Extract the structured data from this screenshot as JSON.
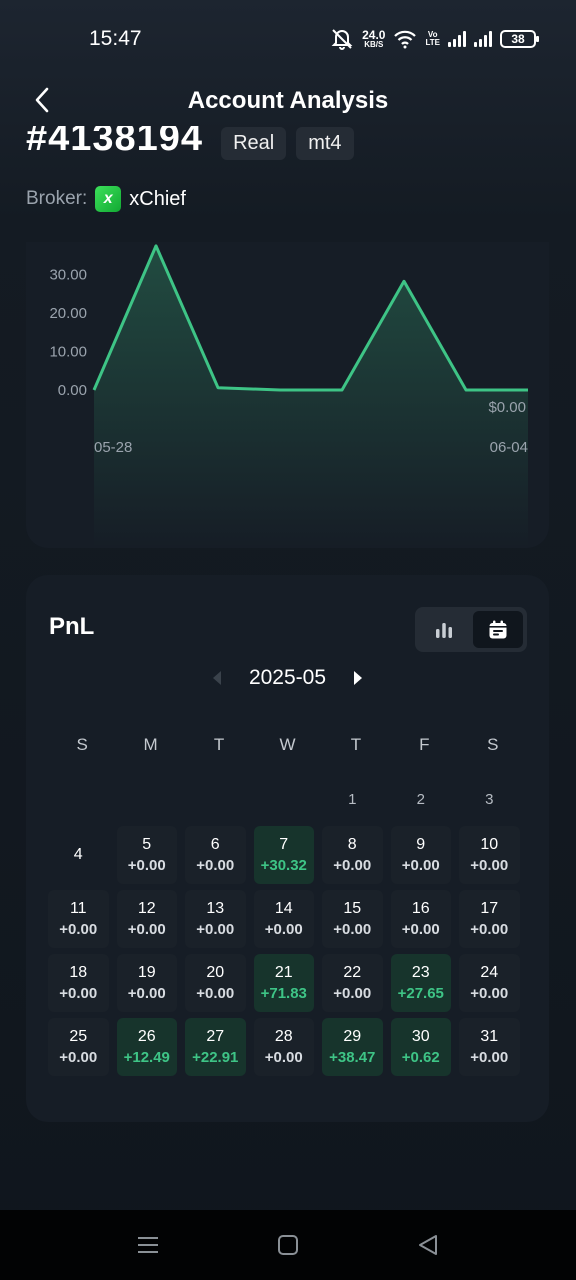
{
  "status_bar": {
    "time": "15:47",
    "net_speed_value": "24.0",
    "net_speed_unit": "KB/S",
    "volte_top": "Vo",
    "volte_bottom": "LTE",
    "battery": "38"
  },
  "header": {
    "title": "Account Analysis",
    "back_icon": "chevron-left-icon"
  },
  "account": {
    "id": "#4138194",
    "tags": [
      "Real",
      "mt4"
    ],
    "broker_label": "Broker:",
    "broker_name": "xChief",
    "broker_logo_letter": "x"
  },
  "chart_data": {
    "type": "area",
    "x": [
      "05-28",
      "05-29",
      "05-30",
      "05-31",
      "06-01",
      "06-02",
      "06-03",
      "06-04"
    ],
    "values": [
      0,
      37.5,
      0.6,
      0,
      0,
      28.3,
      0,
      0
    ],
    "xtick_labels": [
      "05-28",
      "06-04"
    ],
    "ytick_labels": [
      "30.00",
      "20.00",
      "10.00",
      "0.00"
    ],
    "yticks": [
      30,
      20,
      10,
      0
    ],
    "last_value_label": "$0.00",
    "ylim": [
      0,
      38
    ],
    "grid": false,
    "color": "#3ec486"
  },
  "pnl": {
    "title": "PnL",
    "view_icons": [
      "bar-chart-icon",
      "calendar-icon"
    ],
    "active_view": "calendar",
    "month": "2025-05",
    "weekdays": [
      "S",
      "M",
      "T",
      "W",
      "T",
      "F",
      "S"
    ],
    "leading_blank_days": 4,
    "days": [
      {
        "day": "1",
        "value": ""
      },
      {
        "day": "2",
        "value": ""
      },
      {
        "day": "3",
        "value": ""
      },
      {
        "day": "4",
        "value": ""
      },
      {
        "day": "5",
        "value": "+0.00"
      },
      {
        "day": "6",
        "value": "+0.00"
      },
      {
        "day": "7",
        "value": "+30.32",
        "positive": true
      },
      {
        "day": "8",
        "value": "+0.00"
      },
      {
        "day": "9",
        "value": "+0.00"
      },
      {
        "day": "10",
        "value": "+0.00"
      },
      {
        "day": "11",
        "value": "+0.00"
      },
      {
        "day": "12",
        "value": "+0.00"
      },
      {
        "day": "13",
        "value": "+0.00"
      },
      {
        "day": "14",
        "value": "+0.00"
      },
      {
        "day": "15",
        "value": "+0.00"
      },
      {
        "day": "16",
        "value": "+0.00"
      },
      {
        "day": "17",
        "value": "+0.00"
      },
      {
        "day": "18",
        "value": "+0.00"
      },
      {
        "day": "19",
        "value": "+0.00"
      },
      {
        "day": "20",
        "value": "+0.00"
      },
      {
        "day": "21",
        "value": "+71.83",
        "positive": true
      },
      {
        "day": "22",
        "value": "+0.00"
      },
      {
        "day": "23",
        "value": "+27.65",
        "positive": true
      },
      {
        "day": "24",
        "value": "+0.00"
      },
      {
        "day": "25",
        "value": "+0.00"
      },
      {
        "day": "26",
        "value": "+12.49",
        "positive": true
      },
      {
        "day": "27",
        "value": "+22.91",
        "positive": true
      },
      {
        "day": "28",
        "value": "+0.00"
      },
      {
        "day": "29",
        "value": "+38.47",
        "positive": true
      },
      {
        "day": "30",
        "value": "+0.62",
        "positive": true
      },
      {
        "day": "31",
        "value": "+0.00"
      }
    ]
  },
  "nav_bar": {
    "icons": [
      "menu-icon",
      "home-icon",
      "back-icon"
    ]
  },
  "colors": {
    "accent": "#3ec486",
    "card": "#161d26",
    "positive_cell": "#17342c"
  }
}
